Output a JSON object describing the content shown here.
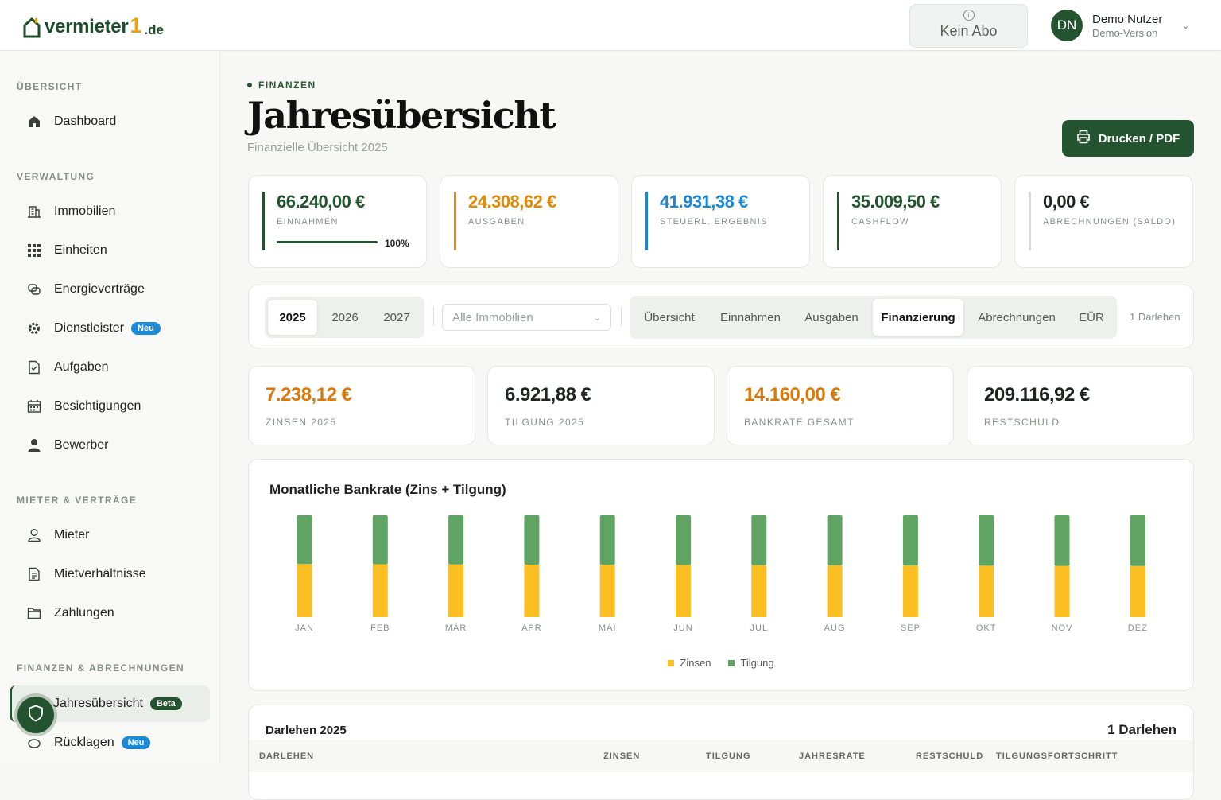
{
  "header": {
    "brand": "vermieter",
    "brand_one": "1",
    "brand_tld": ".de",
    "subscription_label": "Kein Abo",
    "user_initials": "DN",
    "user_name": "Demo Nutzer",
    "user_sub": "Demo-Version"
  },
  "sidebar": {
    "sections": [
      "ÜBERSICHT",
      "VERWALTUNG",
      "MIETER & VERTRÄGE",
      "FINANZEN & ABRECHNUNGEN"
    ],
    "items": [
      {
        "label": "Dashboard",
        "icon": "home-icon"
      },
      {
        "label": "Immobilien",
        "icon": "building-icon"
      },
      {
        "label": "Einheiten",
        "icon": "grid-icon"
      },
      {
        "label": "Energieverträge",
        "icon": "energy-icon"
      },
      {
        "label": "Dienstleister",
        "icon": "gear-icon",
        "badge": "Neu"
      },
      {
        "label": "Aufgaben",
        "icon": "task-icon"
      },
      {
        "label": "Besichtigungen",
        "icon": "calendar-icon"
      },
      {
        "label": "Bewerber",
        "icon": "person-icon"
      },
      {
        "label": "Mieter",
        "icon": "user-icon"
      },
      {
        "label": "Mietverhältnisse",
        "icon": "document-icon"
      },
      {
        "label": "Zahlungen",
        "icon": "folder-icon"
      },
      {
        "label": "Jahresübersicht",
        "icon": "chart-icon",
        "badge": "Beta",
        "active": true
      },
      {
        "label": "Rücklagen",
        "icon": "piggy-icon",
        "badge": "Neu"
      }
    ]
  },
  "page": {
    "crumb": "FINANZEN",
    "title": "Jahresübersicht",
    "subtitle": "Finanzielle Übersicht 2025",
    "print_label": "Drucken / PDF"
  },
  "kpis": [
    {
      "value": "66.240,00 €",
      "label": "EINNAHMEN",
      "color": "#23542f",
      "progress_pct": "100%",
      "progress": 1.0
    },
    {
      "value": "24.308,62 €",
      "label": "AUSGABEN",
      "color": "#e08a0b"
    },
    {
      "value": "41.931,38 €",
      "label": "STEUERL. ERGEBNIS",
      "color": "#1a87d6"
    },
    {
      "value": "35.009,50 €",
      "label": "CASHFLOW",
      "color": "#23542f"
    },
    {
      "value": "0,00 €",
      "label": "ABRECHNUNGEN (SALDO)",
      "color": "#d8dad7"
    }
  ],
  "filters": {
    "years": [
      "2025",
      "2026",
      "2027"
    ],
    "selected_year": "2025",
    "property_placeholder": "Alle Immobilien",
    "tabs": [
      "Übersicht",
      "Einnahmen",
      "Ausgaben",
      "Finanzierung",
      "Abrechnungen",
      "EÜR"
    ],
    "active_tab": "Finanzierung",
    "count": "1 Darlehen"
  },
  "summary": [
    {
      "value": "7.238,12 €",
      "label": "ZINSEN 2025",
      "color": "#d9780b"
    },
    {
      "value": "6.921,88 €",
      "label": "TILGUNG 2025",
      "color": "#1f2421"
    },
    {
      "value": "14.160,00 €",
      "label": "BANKRATE GESAMT",
      "color": "#d9780b"
    },
    {
      "value": "209.116,92 €",
      "label": "RESTSCHULD",
      "color": "#1f2421"
    }
  ],
  "chart_data": {
    "type": "bar",
    "stacked": true,
    "title": "Monatliche Bankrate (Zins + Tilgung)",
    "categories": [
      "JAN",
      "FEB",
      "MÄR",
      "APR",
      "MAI",
      "JUN",
      "JUL",
      "AUG",
      "SEP",
      "OKT",
      "NOV",
      "DEZ"
    ],
    "series": [
      {
        "name": "Zinsen",
        "color": "#fbbf24",
        "values": [
          615,
          613,
          611,
          609,
          607,
          604,
          602,
          600,
          598,
          596,
          594,
          592
        ]
      },
      {
        "name": "Tilgung",
        "color": "#5fa463",
        "values": [
          565,
          567,
          569,
          571,
          573,
          576,
          578,
          580,
          582,
          584,
          586,
          588
        ]
      }
    ],
    "legend": "bottom-center",
    "grid": false
  },
  "loans": {
    "title": "Darlehen 2025",
    "count": "1 Darlehen",
    "columns": [
      "DARLEHEN",
      "ZINSEN",
      "TILGUNG",
      "JAHRESRATE",
      "RESTSCHULD",
      "TILGUNGSFORTSCHRITT"
    ]
  }
}
